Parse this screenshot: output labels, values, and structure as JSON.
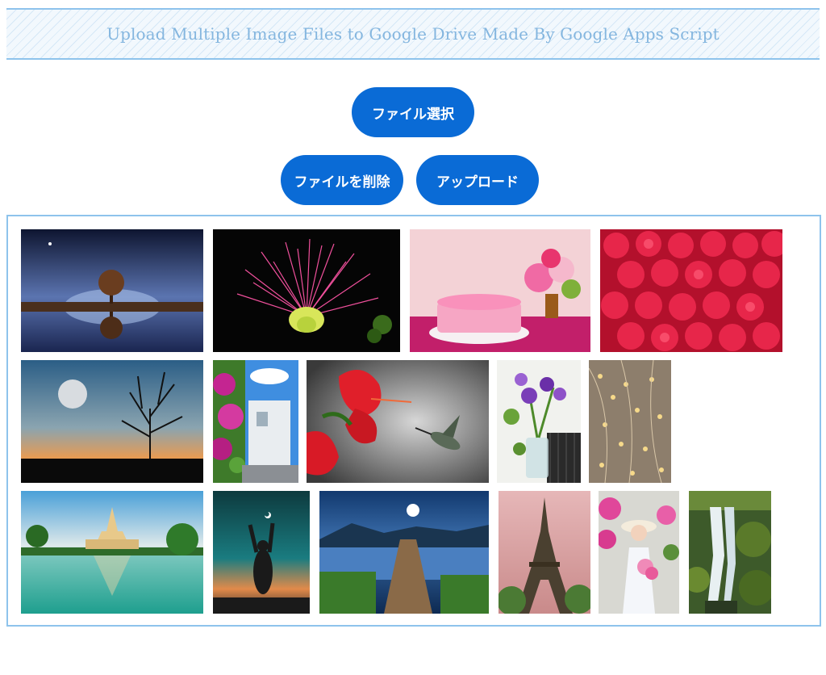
{
  "header": {
    "title": "Upload Multiple Image Files to Google Drive Made By Google Apps Script"
  },
  "buttons": {
    "select_label": "ファイル選択",
    "delete_label": "ファイルを削除",
    "upload_label": "アップロード"
  },
  "colors": {
    "button": "#0a6bd6",
    "border": "#8ec3ec",
    "header_text": "#84b6df"
  },
  "gallery": {
    "images": [
      "tree-reflection-night-image",
      "pink-fluffy-flower-image",
      "birthday-rose-cake-image",
      "red-roses-image",
      "moon-tree-sunset-image",
      "bougainvillea-street-image",
      "hibiscus-hummingbird-image",
      "purple-flowers-vase-image",
      "string-lights-image",
      "temple-reflection-image",
      "silhouette-moon-image",
      "lake-pier-night-image",
      "eiffel-tower-image",
      "girl-with-flowers-image",
      "waterfall-image"
    ]
  }
}
